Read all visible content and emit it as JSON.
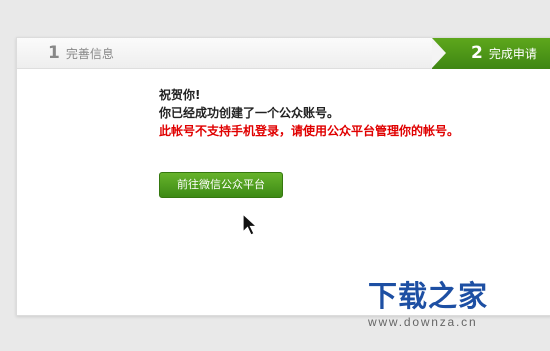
{
  "steps": [
    {
      "number": "1",
      "label": "完善信息"
    },
    {
      "number": "2",
      "label": "完成申请"
    }
  ],
  "message": {
    "line1": "祝贺你!",
    "line2": "你已经成功创建了一个公众账号。",
    "warning": "此帐号不支持手机登录，请使用公众平台管理你的帐号。"
  },
  "button": {
    "label": "前往微信公众平台"
  },
  "watermark": {
    "logo": "下载之家",
    "url": "www.downza.cn"
  },
  "colors": {
    "accent_green": "#4a9a1a",
    "warning_red": "#e00000",
    "watermark_blue": "#1d4fa3"
  },
  "icons": {
    "cursor": "mouse-pointer-icon"
  }
}
